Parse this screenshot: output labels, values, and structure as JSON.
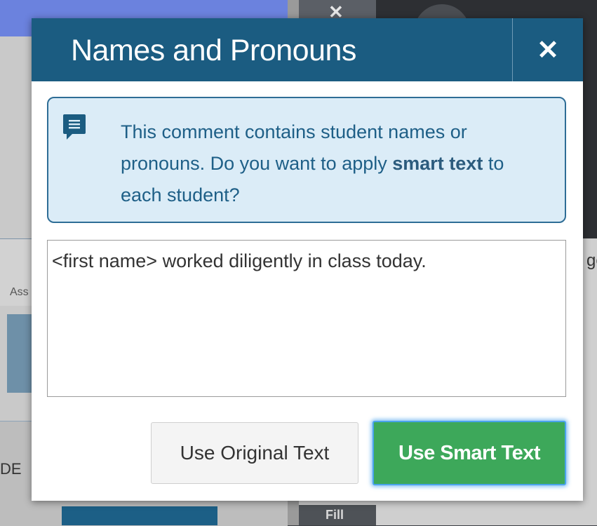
{
  "background": {
    "left_text": "Ass",
    "left_text2": "DE",
    "right_text": "ge",
    "tab_close": "✕",
    "fill_button_label": "Fill"
  },
  "dialog": {
    "title": "Names and Pronouns",
    "close_label": "✕",
    "info": {
      "icon": "comment-icon",
      "text_before": "This comment contains student names or pronouns. Do you want to apply ",
      "link_text": "smart text",
      "text_after": " to each student?"
    },
    "comment_text": "<first name> worked diligently in class today.",
    "buttons": {
      "original_label": "Use Original Text",
      "smart_label": "Use Smart Text"
    }
  },
  "colors": {
    "header": "#1b5c81",
    "info_background": "#dbecf7",
    "info_text": "#1e5f87",
    "primary_button": "#3da85a",
    "focus_ring": "#4aa3ec"
  }
}
